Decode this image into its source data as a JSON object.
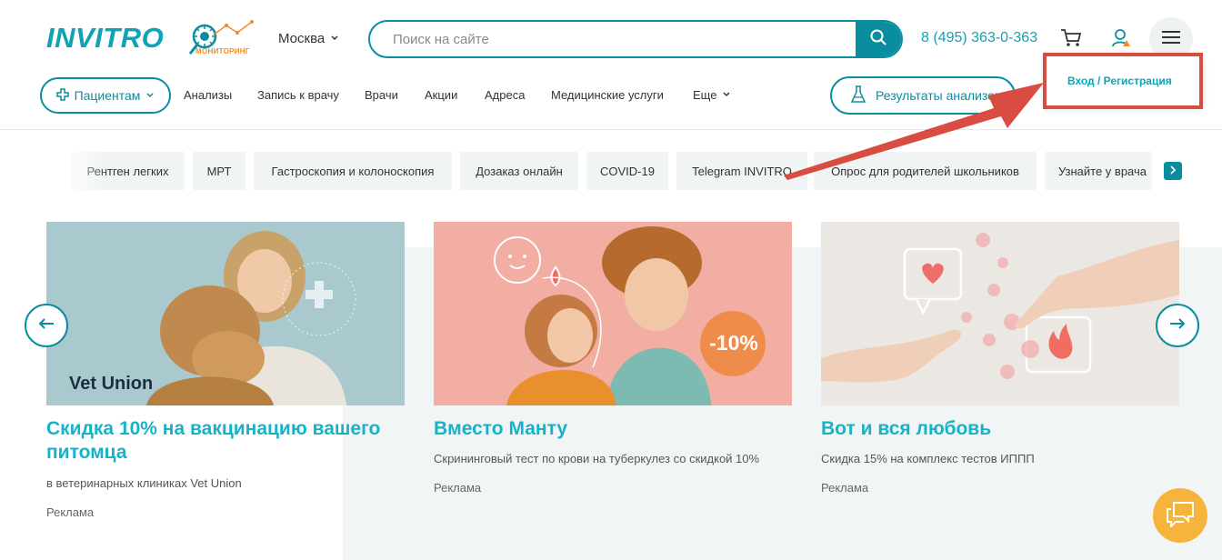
{
  "header": {
    "logo": "INVITRO",
    "monitoring_label": "мониторинг",
    "city": "Москва",
    "search_placeholder": "Поиск на сайте",
    "phone": "8 (495) 363-0-363"
  },
  "nav": {
    "patients": "Пациентам",
    "items": [
      "Анализы",
      "Запись к врачу",
      "Врачи",
      "Акции",
      "Адреса",
      "Медицинские услуги",
      "Еще"
    ],
    "results_button": "Результаты анализов"
  },
  "login_popup": {
    "label": "Вход / Регистрация"
  },
  "chips": [
    "Рентген легких",
    "МРТ",
    "Гастроскопия и колоноскопия",
    "Дозаказ онлайн",
    "COVID-19",
    "Telegram INVITRO",
    "Опрос для родителей школьников",
    "Узнайте у врача"
  ],
  "cards": [
    {
      "image_text": "Vet Union",
      "title": "Скидка 10% на вакцинацию вашего питомца",
      "desc": "в ветеринарных клиниках Vet Union",
      "ad": "Реклама"
    },
    {
      "image_text": "-10%",
      "title": "Вместо Манту",
      "desc": "Скрининговый тест по крови на туберкулез со скидкой 10%",
      "ad": "Реклама"
    },
    {
      "image_text": "",
      "title": "Вот и вся любовь",
      "desc": "Скидка 15% на комплекс тестов ИППП",
      "ad": "Реклама"
    }
  ],
  "colors": {
    "brand": "#0ea3b5",
    "brand_dark": "#0a8e9f",
    "highlight_red": "#d94c42",
    "chat_orange": "#f7b43c"
  }
}
